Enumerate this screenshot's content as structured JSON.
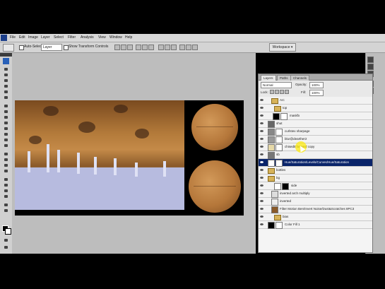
{
  "menu": {
    "items": [
      "File",
      "Edit",
      "Image",
      "Layer",
      "Select",
      "Filter",
      "Analysis",
      "View",
      "Window",
      "Help"
    ]
  },
  "options": {
    "auto_select_label": "Auto-Select:",
    "auto_select_value": "Layer",
    "show_transform_label": "Show Transform Controls",
    "workspace_label": "Workspace ▾"
  },
  "layers_panel": {
    "tabs": [
      "Layers",
      "Paths",
      "Channels"
    ],
    "blend_mode": "Normal",
    "opacity_label": "Opacity:",
    "opacity_value": "100%",
    "lock_label": "Lock:",
    "fill_label": "Fill:",
    "fill_value": "100%",
    "layers": [
      {
        "name": "Arc",
        "type": "folder"
      },
      {
        "name": "top",
        "type": "folder"
      },
      {
        "name": "maskfx",
        "type": "mask"
      },
      {
        "name": "shut",
        "type": "layer"
      },
      {
        "name": "curlstex sharpage",
        "type": "mask"
      },
      {
        "name": "blur@dearther2",
        "type": "mask"
      },
      {
        "name": "chisedit forward copy",
        "type": "mask"
      },
      {
        "name": "sb",
        "type": "layer"
      },
      {
        "name": "Hue/Saturation/Levels/Curves/Hue/Saturation",
        "type": "mask",
        "selected": true
      },
      {
        "name": "bottles",
        "type": "folder"
      },
      {
        "name": "bg",
        "type": "folder"
      },
      {
        "name": "side",
        "type": "mask"
      },
      {
        "name": "inverted arch multiply",
        "type": "layer"
      },
      {
        "name": "inverted",
        "type": "layer"
      },
      {
        "name": "Filter Motion Ben/Invert Noise/Dust&Scratches 8PC3",
        "type": "layer"
      },
      {
        "name": "bias",
        "type": "folder"
      },
      {
        "name": "Color Fill 1",
        "type": "mask"
      }
    ]
  },
  "colors": {
    "accent": "#0a246a",
    "panel_bg": "#e8e8e8",
    "canvas_bg": "#bdbdbd"
  }
}
